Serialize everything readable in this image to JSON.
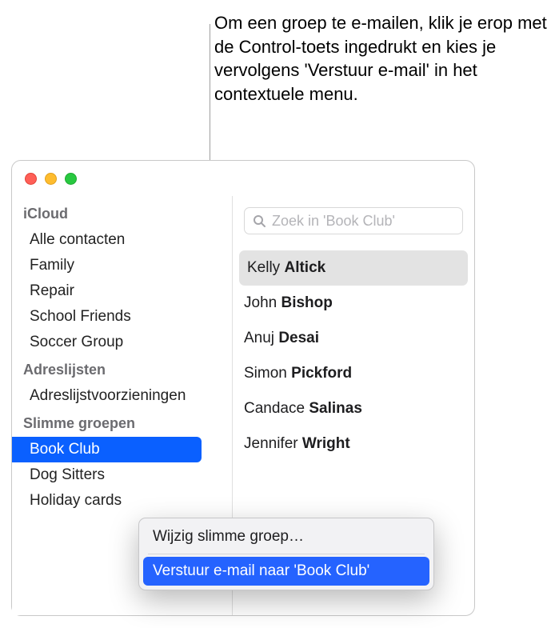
{
  "caption": "Om een groep te e-mailen, klik je erop met de Control-toets ingedrukt en kies je vervolgens 'Verstuur e-mail' in het contextuele menu.",
  "search": {
    "placeholder": "Zoek in 'Book Club'"
  },
  "sidebar": {
    "sections": [
      {
        "header": "iCloud",
        "items": [
          {
            "label": "Alle contacten"
          },
          {
            "label": "Family"
          },
          {
            "label": "Repair"
          },
          {
            "label": "School Friends"
          },
          {
            "label": "Soccer Group"
          }
        ]
      },
      {
        "header": "Adreslijsten",
        "items": [
          {
            "label": "Adreslijstvoorzieningen"
          }
        ]
      },
      {
        "header": "Slimme groepen",
        "items": [
          {
            "label": "Book Club",
            "selected": true
          },
          {
            "label": "Dog Sitters"
          },
          {
            "label": "Holiday cards"
          }
        ]
      }
    ]
  },
  "contacts": [
    {
      "first": "Kelly",
      "last": "Altick",
      "selected": true
    },
    {
      "first": "John",
      "last": "Bishop"
    },
    {
      "first": "Anuj",
      "last": "Desai"
    },
    {
      "first": "Simon",
      "last": "Pickford"
    },
    {
      "first": "Candace",
      "last": "Salinas"
    },
    {
      "first": "Jennifer",
      "last": "Wright"
    }
  ],
  "context_menu": {
    "items": [
      {
        "label": "Wijzig slimme groep…"
      },
      {
        "label": "Verstuur e-mail naar 'Book Club'",
        "highlighted": true
      }
    ]
  }
}
